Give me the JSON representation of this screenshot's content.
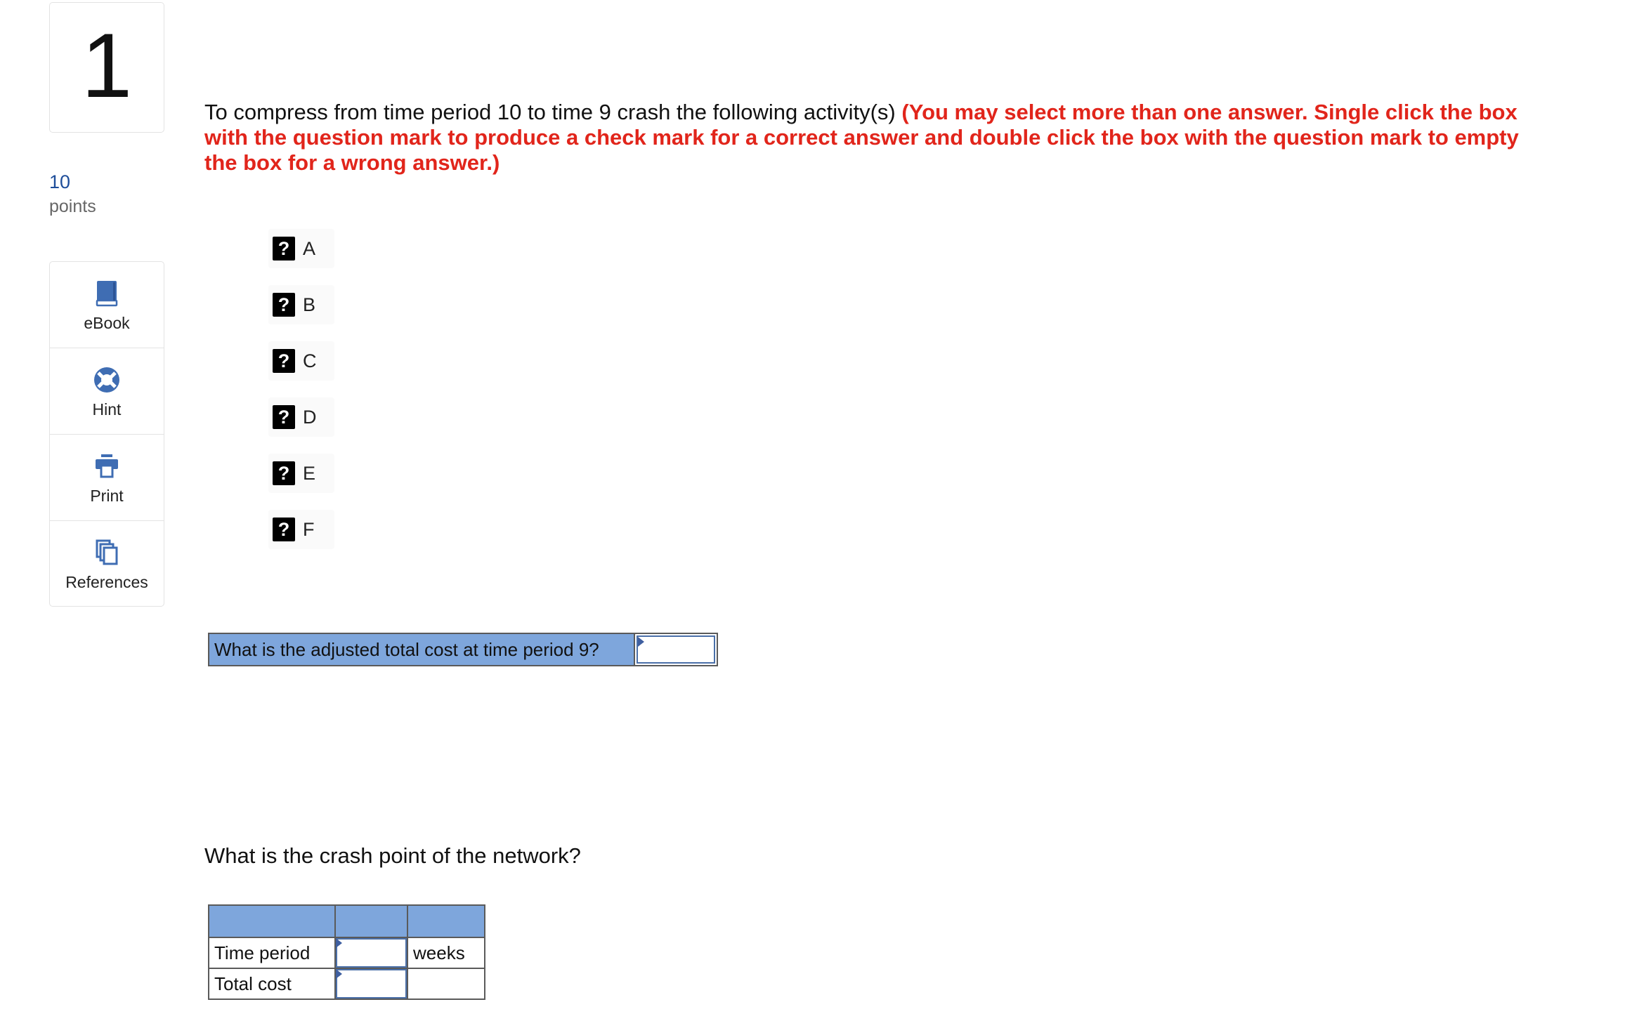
{
  "question": {
    "number": "1",
    "points_value": "10",
    "points_label": "points"
  },
  "tools": [
    {
      "label": "eBook",
      "icon": "book-icon"
    },
    {
      "label": "Hint",
      "icon": "lifebuoy-icon"
    },
    {
      "label": "Print",
      "icon": "printer-icon"
    },
    {
      "label": "References",
      "icon": "copy-icon"
    }
  ],
  "prompt": {
    "text": "To compress from time period 10 to time 9 crash the following activity(s) ",
    "instructions": "(You may select more than one answer. Single click the box with the question mark to produce a check mark for a correct answer and double click the box with the question mark to empty the box for a wrong answer.)"
  },
  "choices": [
    {
      "mark": "?",
      "label": "A"
    },
    {
      "mark": "?",
      "label": "B"
    },
    {
      "mark": "?",
      "label": "C"
    },
    {
      "mark": "?",
      "label": "D"
    },
    {
      "mark": "?",
      "label": "E"
    },
    {
      "mark": "?",
      "label": "F"
    }
  ],
  "adjusted_cost": {
    "question": "What is the adjusted total cost at time period 9?",
    "value": ""
  },
  "crash_point": {
    "question": "What is the crash point of the network?",
    "rows": [
      {
        "label": "Time period",
        "value": "",
        "unit": "weeks"
      },
      {
        "label": "Total cost",
        "value": "",
        "unit": ""
      }
    ]
  },
  "colors": {
    "accent_red": "#e1251b",
    "table_header_blue": "#7ea6dc",
    "icon_blue": "#3f6db3",
    "points_blue": "#1f4e9a"
  }
}
